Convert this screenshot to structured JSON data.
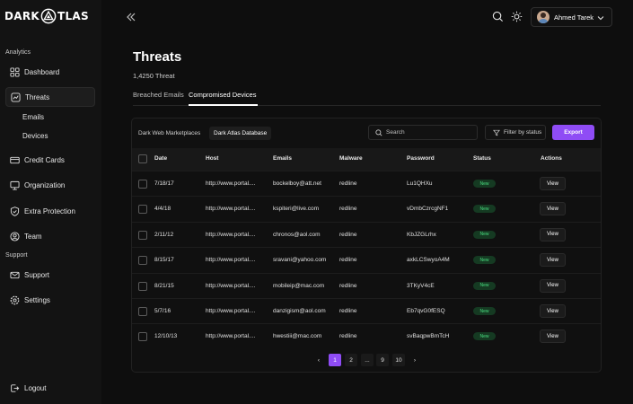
{
  "brand": {
    "left": "DARK",
    "right": "TLAS"
  },
  "sidebar": {
    "section_analytics": "Analytics",
    "section_support": "Support",
    "items": {
      "dashboard": "Dashboard",
      "threats": "Threats",
      "emails": "Emails",
      "devices": "Devices",
      "credit_cards": "Credit Cards",
      "organization": "Organization",
      "extra_protection": "Extra Protection",
      "team": "Team",
      "support": "Support",
      "settings": "Settings",
      "logout": "Logout"
    }
  },
  "header": {
    "user_name": "Ahmed Tarek"
  },
  "page": {
    "title": "Threats",
    "count": "1,4250 Threat",
    "tabs": [
      "Breached Emails",
      "Compromised Devices"
    ],
    "active_tab": "Compromised Devices"
  },
  "toolbar": {
    "sources": [
      "Dark Web Marketplaces",
      "Dark Atlas Database"
    ],
    "active_source": "Dark Atlas Database",
    "search_placeholder": "Search",
    "filter_label": "Filter by status",
    "export_label": "Export"
  },
  "table": {
    "columns": [
      "Date",
      "Host",
      "Emails",
      "Malware",
      "Password",
      "Status",
      "Actions"
    ],
    "rows": [
      [
        "7/18/17",
        "http://www.portal....",
        "bockelboy@att.net",
        "redline",
        "Lu1QHXu",
        "New",
        "View"
      ],
      [
        "4/4/18",
        "http://www.portal....",
        "kspiteri@live.com",
        "redline",
        "vDmbCzrcgNF1",
        "New",
        "View"
      ],
      [
        "2/11/12",
        "http://www.portal....",
        "chronos@aol.com",
        "redline",
        "KbJZGLrhx",
        "New",
        "View"
      ],
      [
        "8/15/17",
        "http://www.portal....",
        "sravani@yahoo.com",
        "redline",
        "axkLCSwyoA4M",
        "New",
        "View"
      ],
      [
        "8/21/15",
        "http://www.portal....",
        "mobileip@mac.com",
        "redline",
        "3TKyV4cE",
        "New",
        "View"
      ],
      [
        "5/7/16",
        "http://www.portal....",
        "danzigism@aol.com",
        "redline",
        "Eb7qvG0fESQ",
        "New",
        "View"
      ],
      [
        "12/10/13",
        "http://www.portal....",
        "hwestiii@mac.com",
        "redline",
        "svBaqpwBmTcH",
        "New",
        "View"
      ]
    ]
  },
  "pagination": {
    "pages": [
      "1",
      "2",
      "...",
      "9",
      "10"
    ],
    "current": "1",
    "prev": "‹",
    "next": "›"
  },
  "colors": {
    "accent": "#8f4cf5",
    "status_new": "#4ade80",
    "background": "#0e0e0e",
    "sidebar": "#131313"
  }
}
